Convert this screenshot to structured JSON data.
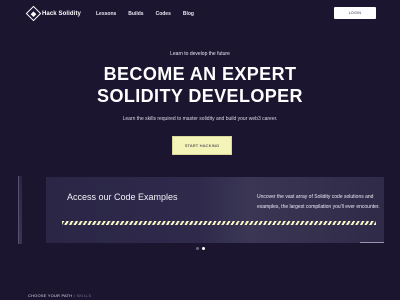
{
  "brand": {
    "name": "Hack Solidity"
  },
  "nav": {
    "links": [
      "Lessons",
      "Builds",
      "Codes",
      "Blog"
    ],
    "login_label": "LOGIN"
  },
  "hero": {
    "tagline": "Learn to develop the future",
    "headline_line1": "BECOME AN EXPERT",
    "headline_line2": "SOLIDITY DEVELOPER",
    "subtext": "Learn the skills required to master solidity and build your web3 career.",
    "cta_label": "START HACKING"
  },
  "feature": {
    "title": "Access our Code Examples",
    "description": "Uncover the vast array of Solidity code solutions and examples, the largest compilation you'll ever encounter."
  },
  "carousel": {
    "slide_count": 2,
    "active_index": 1
  },
  "path_section": {
    "label": "CHOOSE YOUR PATH",
    "label_suffix": "• SKILLS"
  }
}
